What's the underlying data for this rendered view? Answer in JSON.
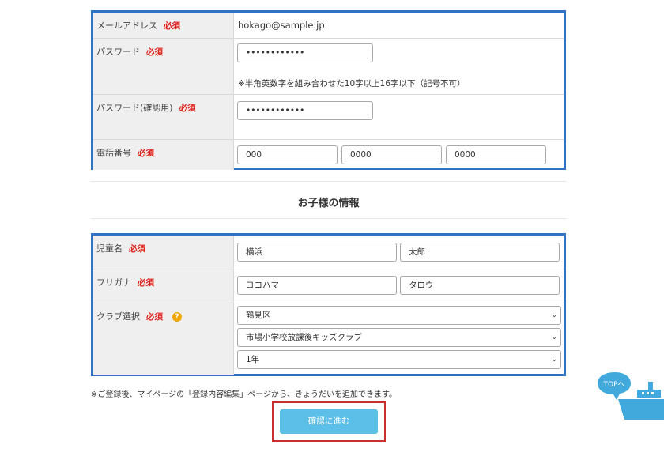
{
  "account": {
    "email": {
      "label": "メールアドレス",
      "required": "必須",
      "value": "hokago@sample.jp"
    },
    "password": {
      "label": "パスワード",
      "required": "必須",
      "value": "••••••••••••",
      "note": "※半角英数字を組み合わせた10字以上16字以下（記号不可）"
    },
    "password_confirm": {
      "label": "パスワード(確認用)",
      "required": "必須",
      "value": "••••••••••••"
    },
    "phone": {
      "label": "電話番号",
      "required": "必須",
      "parts": [
        "000",
        "0000",
        "0000"
      ]
    }
  },
  "child_section": {
    "title": "お子様の情報"
  },
  "child": {
    "name": {
      "label": "児童名",
      "required": "必須",
      "last": "横浜",
      "first": "太郎"
    },
    "kana": {
      "label": "フリガナ",
      "required": "必須",
      "last": "ヨコハマ",
      "first": "タロウ"
    },
    "club": {
      "label": "クラブ選択",
      "required": "必須",
      "help": "?",
      "ward": "鶴見区",
      "club_name": "市場小学校放課後キッズクラブ",
      "grade": "1年"
    }
  },
  "footer_note": "※ご登録後、マイページの「登録内容編集」ページから、きょうだいを追加できます。",
  "submit_label": "確認に進む",
  "top_button_label": "TOPへ",
  "colors": {
    "accent_border": "#2f73c7",
    "required": "#e0201a",
    "submit": "#5bbfe8",
    "submit_outline": "#c8302b",
    "top_icon": "#41a9dc"
  }
}
